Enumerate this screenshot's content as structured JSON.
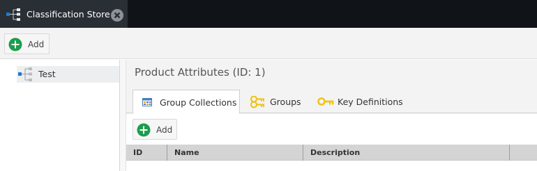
{
  "tabbar": {
    "tab_title": "Classification Store",
    "tab_icon": "tree-icon",
    "close_icon": "close-icon"
  },
  "toolbar": {
    "add_label": "Add"
  },
  "tree": {
    "items": [
      {
        "label": "Test",
        "icon": "tree-icon"
      }
    ]
  },
  "main": {
    "title": "Product Attributes (ID: 1)",
    "tabs": [
      {
        "label": "Group Collections",
        "icon": "grid-icon",
        "active": true
      },
      {
        "label": "Groups",
        "icon": "keys-icon",
        "active": false
      },
      {
        "label": "Key Definitions",
        "icon": "key-icon",
        "active": false
      }
    ],
    "add_label": "Add",
    "grid": {
      "columns": [
        "ID",
        "Name",
        "Description"
      ]
    }
  },
  "colors": {
    "tabbar_bg": "#101317",
    "active_tab_bg": "#2a2e35",
    "add_green": "#1b9e4b",
    "key_yellow": "#f0c419",
    "tree_blue": "#1a7cd0"
  }
}
